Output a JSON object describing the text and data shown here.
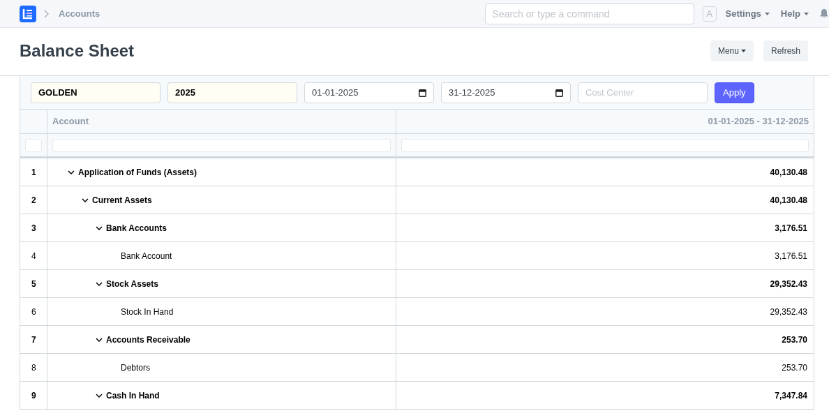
{
  "navbar": {
    "breadcrumb": "Accounts",
    "search": {
      "placeholder": "Search or type a command"
    },
    "avatar": "A",
    "menus": [
      "Settings",
      "Help"
    ]
  },
  "page": {
    "title": "Balance Sheet",
    "buttons": [
      {
        "label": "Menu",
        "dropdown": true
      },
      {
        "label": "Refresh",
        "dropdown": false
      }
    ]
  },
  "filters": [
    {
      "kind": "link",
      "value": "GOLDEN"
    },
    {
      "kind": "link",
      "value": "2025"
    },
    {
      "kind": "date",
      "value": "01-01-2025"
    },
    {
      "kind": "date",
      "value": "31-12-2025"
    },
    {
      "kind": "text",
      "placeholder": "Cost Center"
    }
  ],
  "apply_button": "Apply",
  "table": {
    "columns": [
      "Account",
      "01-01-2025 - 31-12-2025"
    ],
    "rows": [
      {
        "index": "1",
        "account": "Application of Funds (Assets)",
        "amount": "40,130.48",
        "expanded": true,
        "children": [
          {
            "index": "2",
            "account": "Current Assets",
            "amount": "40,130.48",
            "expanded": true,
            "children": [
              {
                "index": "3",
                "account": "Bank Accounts",
                "amount": "3,176.51",
                "expanded": true,
                "children": [
                  {
                    "index": "4",
                    "account": "Bank Account",
                    "amount": "3,176.51"
                  }
                ]
              },
              {
                "index": "5",
                "account": "Stock Assets",
                "amount": "29,352.43",
                "expanded": true,
                "children": [
                  {
                    "index": "6",
                    "account": "Stock In Hand",
                    "amount": "29,352.43"
                  }
                ]
              },
              {
                "index": "7",
                "account": "Accounts Receivable",
                "amount": "253.70",
                "expanded": true,
                "children": [
                  {
                    "index": "8",
                    "account": "Debtors",
                    "amount": "253.70"
                  }
                ]
              },
              {
                "index": "9",
                "account": "Cash In Hand",
                "amount": "7,347.84",
                "expanded": true
              }
            ]
          }
        ]
      }
    ]
  }
}
